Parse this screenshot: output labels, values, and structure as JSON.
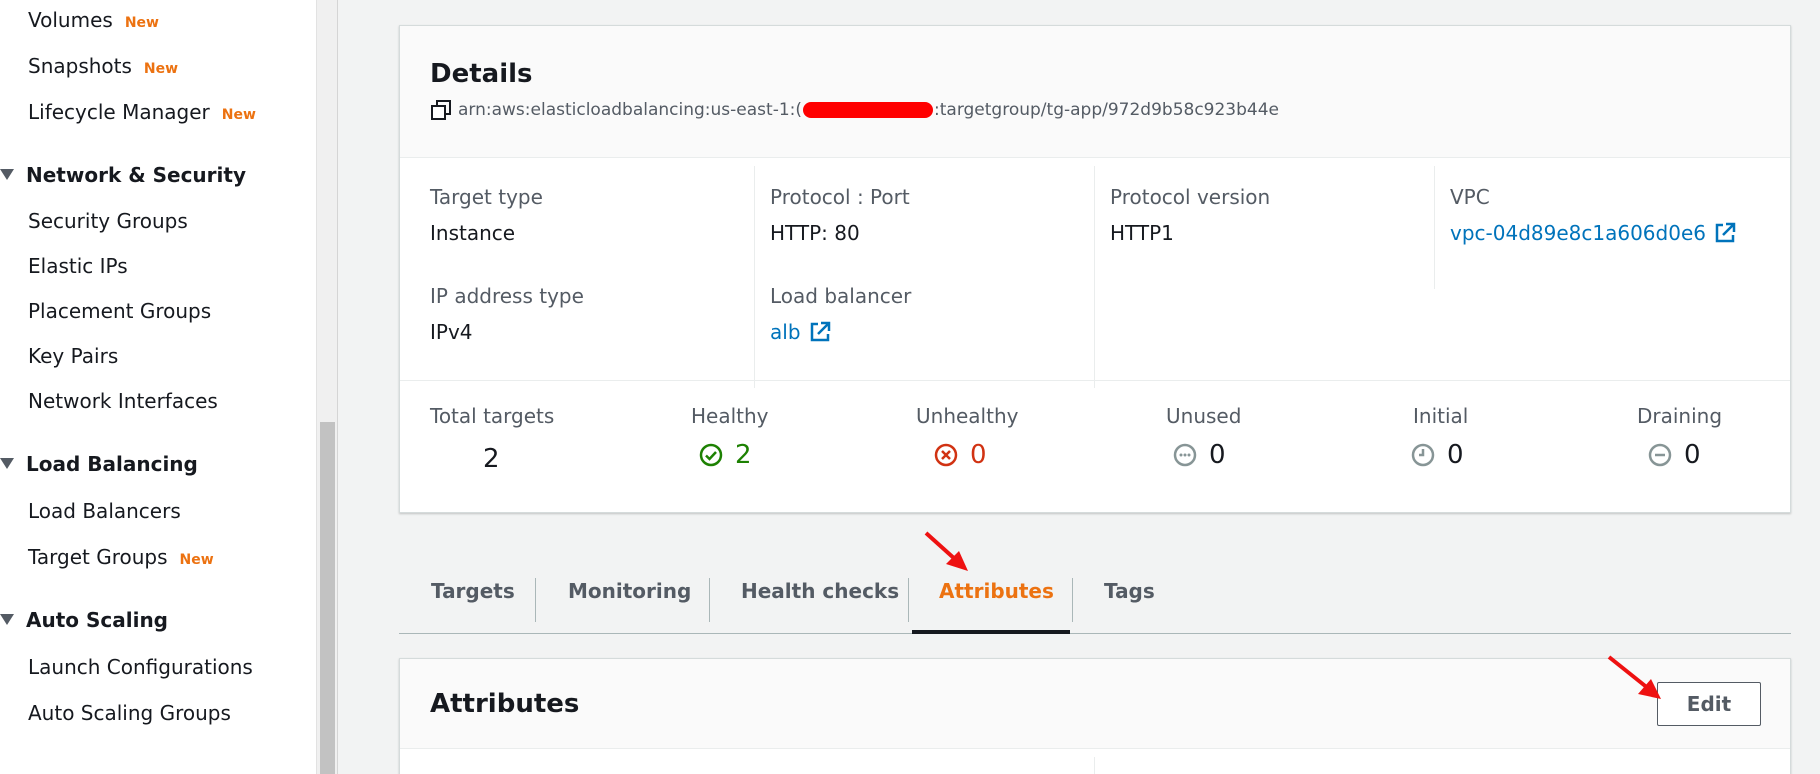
{
  "sidebar": {
    "items": [
      {
        "label": "Volumes",
        "badge": "New"
      },
      {
        "label": "Snapshots",
        "badge": "New"
      },
      {
        "label": "Lifecycle Manager",
        "badge": "New"
      },
      {
        "label": "Network & Security",
        "type": "section"
      },
      {
        "label": "Security Groups"
      },
      {
        "label": "Elastic IPs"
      },
      {
        "label": "Placement Groups"
      },
      {
        "label": "Key Pairs"
      },
      {
        "label": "Network Interfaces"
      },
      {
        "label": "Load Balancing",
        "type": "section"
      },
      {
        "label": "Load Balancers"
      },
      {
        "label": "Target Groups",
        "badge": "New"
      },
      {
        "label": "Auto Scaling",
        "type": "section"
      },
      {
        "label": "Launch Configurations"
      },
      {
        "label": "Auto Scaling Groups"
      }
    ]
  },
  "details": {
    "title": "Details",
    "arn_prefix": "arn:aws:elasticloadbalancing:us-east-1:",
    "arn_prefix_char": "(",
    "arn_suffix": ":targetgroup/tg-app/972d9b58c923b44e",
    "fields": {
      "target_type": {
        "label": "Target type",
        "value": "Instance"
      },
      "protocol_port": {
        "label": "Protocol : Port",
        "value": "HTTP: 80"
      },
      "protocol_version": {
        "label": "Protocol version",
        "value": "HTTP1"
      },
      "vpc": {
        "label": "VPC",
        "value": "vpc-04d89e8c1a606d0e6"
      },
      "ip_address_type": {
        "label": "IP address type",
        "value": "IPv4"
      },
      "load_balancer": {
        "label": "Load balancer",
        "value": "alb"
      }
    },
    "stats": {
      "total": {
        "label": "Total targets",
        "value": "2"
      },
      "healthy": {
        "label": "Healthy",
        "value": "2",
        "color": "#1d8102"
      },
      "unhealthy": {
        "label": "Unhealthy",
        "value": "0",
        "color": "#d13212"
      },
      "unused": {
        "label": "Unused",
        "value": "0",
        "color": "#16191f"
      },
      "initial": {
        "label": "Initial",
        "value": "0",
        "color": "#16191f"
      },
      "draining": {
        "label": "Draining",
        "value": "0",
        "color": "#16191f"
      }
    }
  },
  "tabs": [
    {
      "label": "Targets"
    },
    {
      "label": "Monitoring"
    },
    {
      "label": "Health checks"
    },
    {
      "label": "Attributes",
      "active": true
    },
    {
      "label": "Tags"
    }
  ],
  "attributes": {
    "title": "Attributes",
    "edit_label": "Edit"
  },
  "colors": {
    "accent_orange": "#ec7211",
    "link_blue": "#0073bb",
    "annotation_red": "#ee1111"
  },
  "icons": [
    "copy-icon",
    "external-link-icon",
    "check-circle-icon",
    "x-circle-icon",
    "dots-circle-icon",
    "clock-circle-icon",
    "minus-circle-icon",
    "red-arrow-annotation"
  ]
}
